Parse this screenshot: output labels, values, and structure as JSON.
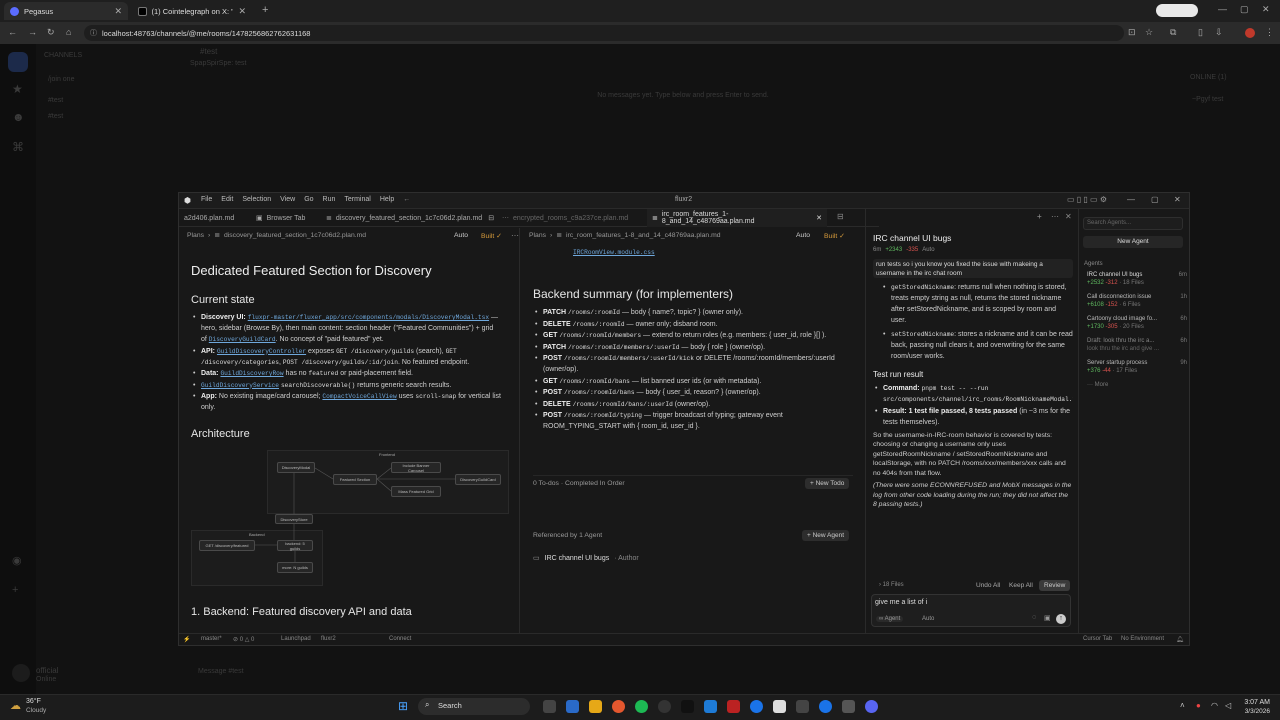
{
  "browser": {
    "tabs": [
      {
        "label": "Pegasus",
        "active": true
      },
      {
        "label": "(1) Cointelegraph on X: \"⚡ JUS",
        "active": false
      }
    ],
    "url": "localhost:48763/channels/@me/rooms/1478256862762631168"
  },
  "background_app": {
    "channel_title": "#test",
    "channel_sub": "SpapSpirSpe: test",
    "sidebar_heading": "CHANNELS",
    "sidebar_items": [
      "/join one",
      "#test",
      "#test"
    ],
    "empty_message": "No messages yet. Type below and press Enter to send.",
    "online_label": "ONLINE (1)",
    "online_user": "~Pgyf test",
    "user_name": "official",
    "user_status": "Online",
    "composer_placeholder": "Message #test"
  },
  "ide": {
    "title": "fluxr2",
    "menu": [
      "File",
      "Edit",
      "Selection",
      "View",
      "Go",
      "Run",
      "Terminal",
      "Help"
    ],
    "tabs": [
      {
        "label": "a2d406.plan.md",
        "active": false
      },
      {
        "label": "Browser Tab",
        "active": false
      },
      {
        "label": "discovery_featured_section_1c7c06d2.plan.md",
        "active": false
      },
      {
        "label": "encrypted_rooms_c9a237ce.plan.md",
        "active": false
      },
      {
        "label": "irc_room_features_1-8_and_14_c48769aa.plan.md",
        "active": true
      }
    ],
    "left_pane": {
      "breadcrumb": [
        "Plans",
        "discovery_featured_section_1c7c06d2.plan.md"
      ],
      "mode": "Auto",
      "built": "Built ✓",
      "h1": "Dedicated Featured Section for Discovery",
      "current_state_heading": "Current state",
      "bullets": [
        {
          "label": "Discovery UI:",
          "code": "fluxpr-master/fluxer_app/src/components/modals/DiscoveryModal.tsx",
          "text": "— hero, sidebar (Browse By), then main content: section header (\"Featured Communities\") + grid of",
          "code2": "DiscoveryGuildCard",
          "text2": ". No concept of \"paid featured\" yet."
        },
        {
          "label": "API:",
          "code": "GuildDiscoveryController",
          "text": "exposes",
          "code2": "GET /discovery/guilds",
          "text2": "(search),",
          "code3": "GET /discovery/categories",
          "code4": "POST /discovery/guilds/:id/join",
          "text3": ". No featured endpoint."
        },
        {
          "label": "Data:",
          "code": "GuildDiscoveryRow",
          "text": "has no",
          "code2": "featured",
          "text2": "or paid-placement field."
        },
        {
          "label": "",
          "code": "GuildDiscoveryService",
          "code2": "searchDiscoverable()",
          "text": "returns generic search results."
        },
        {
          "label": "App:",
          "text": "No existing image/card carousel;",
          "code": "CompactVoiceCallView",
          "text2": "uses",
          "code2": "scroll-snap",
          "text3": "for vertical list only."
        }
      ],
      "architecture_heading": "Architecture",
      "diagram": {
        "frontend_label": "Frontend",
        "backend_label": "Backend",
        "nodes": [
          "DiscoveryModal",
          "Featured Section",
          "Include Banner Carousel",
          "DiscoveryGuildCard",
          "Mass Featured Grid",
          "DiscoveryStore",
          "GET /discovery/featured",
          "backend: 5 guilds",
          "more: N guilds"
        ]
      },
      "next_heading": "1. Backend: Featured discovery API and data"
    },
    "mid_pane": {
      "breadcrumb": [
        "Plans",
        "irc_room_features_1-8_and_14_c48769aa.plan.md"
      ],
      "mode": "Auto",
      "built": "Built ✓",
      "top_file": "IRCRoomView.module.css",
      "heading": "Backend summary (for implementers)",
      "endpoints": [
        {
          "method": "PATCH",
          "path": "/rooms/:roomId",
          "desc": "— body { name?, topic? } (owner only)."
        },
        {
          "method": "DELETE",
          "path": "/rooms/:roomId",
          "desc": "— owner only; disband room."
        },
        {
          "method": "GET",
          "path": "/rooms/:roomId/members",
          "desc": "— extend to return roles (e.g. members: { user_id, role }[] )."
        },
        {
          "method": "PATCH",
          "path": "/rooms/:roomId/members/:userId",
          "desc": "— body { role } (owner/op)."
        },
        {
          "method": "POST",
          "path": "/rooms/:roomId/members/:userId/kick",
          "desc": "or DELETE /rooms/:roomId/members/:userId (owner/op)."
        },
        {
          "method": "GET",
          "path": "/rooms/:roomId/bans",
          "desc": "— list banned user ids (or with metadata)."
        },
        {
          "method": "POST",
          "path": "/rooms/:roomId/bans",
          "desc": "— body { user_id, reason? } (owner/op)."
        },
        {
          "method": "DELETE",
          "path": "/rooms/:roomId/bans/:userId",
          "desc": "(owner/op)."
        },
        {
          "method": "POST",
          "path": "/rooms/:roomId/typing",
          "desc": "— trigger broadcast of typing; gateway event ROOM_TYPING_START with { room_id, user_id }."
        }
      ],
      "todos": "0 To-dos · Completed In Order",
      "new_todo": "+ New Todo",
      "referenced": "Referenced by 1 Agent",
      "new_agent": "+ New Agent",
      "agent_ref": "IRC channel UI bugs",
      "agent_ref_role": "· Author"
    },
    "chat": {
      "title": "IRC channel UI bugs",
      "meta": "6m",
      "added": "+2343",
      "removed": "-335",
      "mode": "Auto",
      "user_msg": "run tests so i you know you fixed the issue with makeing a username in the irc chat room",
      "bullets": [
        {
          "code": "getStoredNickname",
          "text": ": returns null when nothing is stored, treats empty string as null, returns the stored nickname after setStoredNickname, and is scoped by room and user."
        },
        {
          "code": "setStoredNickname",
          "text": ": stores a nickname and it can be read back, passing null clears it, and overwriting for the same room/user works."
        }
      ],
      "result_heading": "Test run result",
      "command_label": "Command:",
      "command": "pnpm test -- --run src/components/channel/irc_rooms/RoomNicknameModal.test.tsx",
      "result_label": "Result: 1 test file passed, 8 tests passed",
      "result_text": "(in ~3 ms for the tests themselves).",
      "summary": "So the username-in-IRC-room behavior is covered by tests: choosing or changing a username only uses getStoredRoomNickname / setStoredRoomNickname and localStorage, with no PATCH /rooms/xxx/members/xxx calls and no 404s from that flow.",
      "note": "(There were some ECONNREFUSED and MobX messages in the log from other code loading during the run; they did not affect the 8 passing tests.)",
      "files": "› 18 Files",
      "undo_all": "Undo All",
      "keep_all": "Keep All",
      "review": "Review",
      "input_value": "give me a list of i",
      "agent_mode": "∞ Agent",
      "model": "Auto"
    },
    "agents_panel": {
      "search_placeholder": "Search Agents...",
      "new_agent": "New Agent",
      "heading": "Agents",
      "items": [
        {
          "title": "IRC channel UI bugs",
          "time": "6m",
          "added": "+2532",
          "removed": "-312",
          "files": "· 18 Files",
          "active": true
        },
        {
          "title": "Call disconnection issue",
          "time": "1h",
          "added": "+6108",
          "removed": "-152",
          "files": "· 6 Files",
          "active": false
        },
        {
          "title": "Cartoony cloud image fo...",
          "time": "6h",
          "added": "+1730",
          "removed": "-305",
          "files": "· 20 Files",
          "active": false
        },
        {
          "title": "Draft: look thru the irc a...",
          "time": "6h",
          "sub": "look thru the irc and give ...",
          "active": false
        },
        {
          "title": "Server startup process",
          "time": "9h",
          "added": "+376",
          "removed": "-44",
          "files": "· 17 Files",
          "active": false
        }
      ],
      "more": "··· More"
    },
    "status": {
      "branch": "master*",
      "counts": "⊘ 0 △ 0",
      "launchpad": "Launchpad",
      "project": "fluxr2",
      "connect": "Connect",
      "cursor_tab": "Cursor Tab",
      "env": "No Environment"
    }
  },
  "taskbar": {
    "weather_temp": "36°F",
    "weather_desc": "Cloudy",
    "search_label": "Search",
    "time": "3:07 AM",
    "date": "3/3/2026"
  },
  "colors": {
    "accent_blue": "#6fa8dc",
    "added": "#5fb85f",
    "removed": "#d9534f",
    "built": "#d79b3b"
  }
}
